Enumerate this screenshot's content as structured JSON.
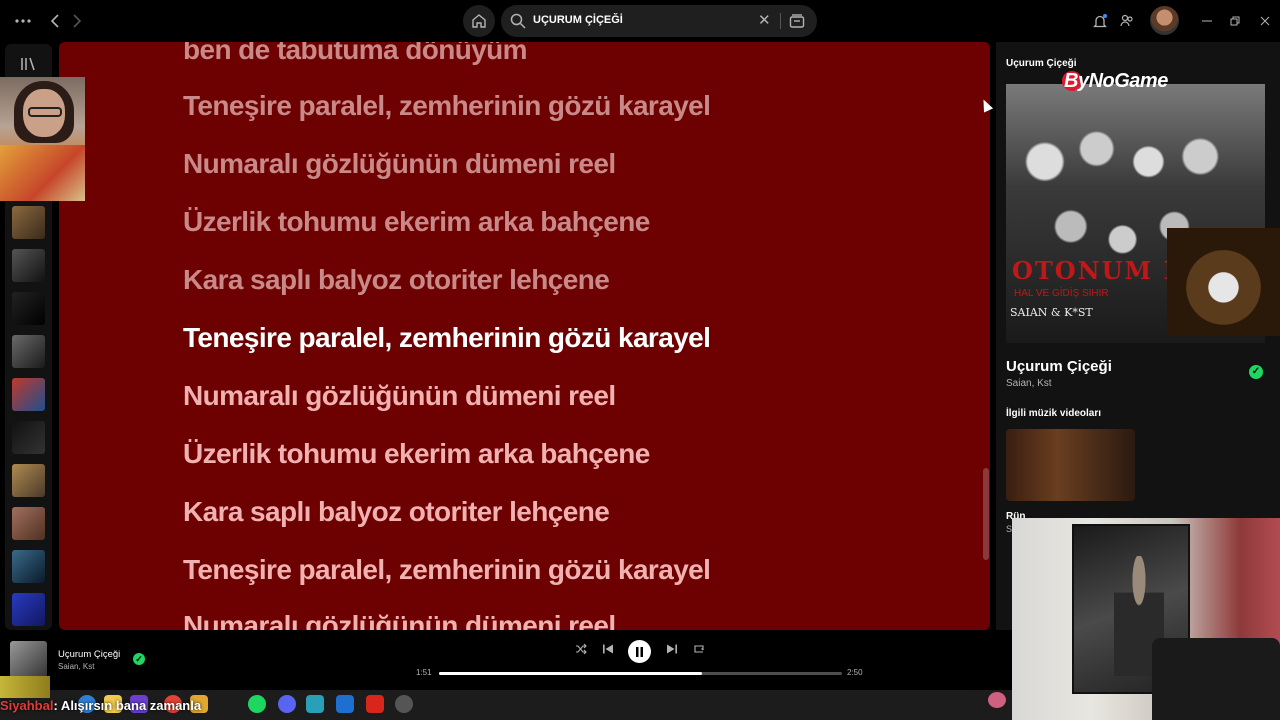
{
  "topbar": {
    "menu_icon": "more-horizontal-icon",
    "search": {
      "query": "UÇURUM ÇİÇEĞİ"
    }
  },
  "lyrics": {
    "lines": [
      {
        "text": "ben de tabutuma dönüyüm",
        "state": "past"
      },
      {
        "text": "Teneşire paralel, zemherinin gözü karayel",
        "state": "past"
      },
      {
        "text": "Numaralı gözlüğünün dümeni reel",
        "state": "past"
      },
      {
        "text": "Üzerlik tohumu ekerim arka bahçene",
        "state": "past"
      },
      {
        "text": "Kara saplı balyoz otoriter lehçene",
        "state": "past"
      },
      {
        "text": "Teneşire paralel, zemherinin gözü karayel",
        "state": "active"
      },
      {
        "text": "Numaralı gözlüğünün dümeni reel",
        "state": "future"
      },
      {
        "text": "Üzerlik tohumu ekerim arka bahçene",
        "state": "future"
      },
      {
        "text": "Kara saplı balyoz otoriter lehçene",
        "state": "future"
      },
      {
        "text": "Teneşire paralel, zemherinin gözü karayel",
        "state": "future"
      },
      {
        "text": "Numaralı gözlüğünün dümeni reel",
        "state": "future"
      }
    ]
  },
  "right_panel": {
    "header": "Uçurum Çiçeği",
    "watermark": "ByNoGame",
    "cover": {
      "title": "OTONUM PİYA",
      "subtitle": "HAL VE GİDİŞ SIHIR",
      "artists": "SAIAN & K*ST"
    },
    "song_title": "Uçurum Çiçeği",
    "song_artists": "Saian, Kst",
    "related_header": "İlgili müzik videoları",
    "video_title": "Rün",
    "video_sub": "S"
  },
  "player": {
    "title": "Uçurum Çiçeği",
    "artists": "Saian, Kst",
    "elapsed": "1:51",
    "duration": "2:50",
    "progress": 0.653
  },
  "chat": {
    "user": "Siyahbal",
    "message": ": Alışırsın bana zamanla"
  },
  "colors": {
    "lyrics_bg": "#6d0000",
    "accent": "#1ed760"
  }
}
